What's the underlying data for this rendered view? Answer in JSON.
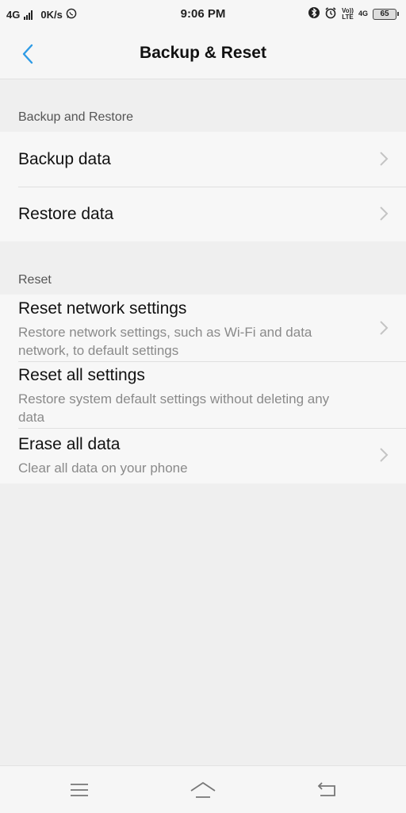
{
  "status_bar": {
    "network_type": "4G",
    "data_speed": "0K/s",
    "time": "9:06 PM",
    "volte_top": "Vo))",
    "volte_bottom": "LTE",
    "network_right": "4G",
    "battery_level": "65",
    "icons": [
      "whatsapp-icon",
      "bluetooth-icon",
      "alarm-icon"
    ]
  },
  "header": {
    "title": "Backup & Reset",
    "back_icon": "chevron-left-icon",
    "accent_color": "#2e9be6"
  },
  "sections": [
    {
      "label": "Backup and Restore",
      "items": [
        {
          "title": "Backup data"
        },
        {
          "title": "Restore data"
        }
      ]
    },
    {
      "label": "Reset",
      "items": [
        {
          "title": "Reset network settings",
          "subtitle_line1": "Restore network settings, such as Wi-Fi and data",
          "subtitle_line2": "network, to default settings"
        },
        {
          "title": "Reset all settings",
          "subtitle_line1": "Restore system default settings without deleting any",
          "subtitle_line2": "data"
        },
        {
          "title": "Erase all data",
          "subtitle_line1": "Clear all data on your phone"
        }
      ]
    }
  ],
  "nav_bar": {
    "icons": [
      "menu-icon",
      "home-icon",
      "back-icon"
    ]
  }
}
